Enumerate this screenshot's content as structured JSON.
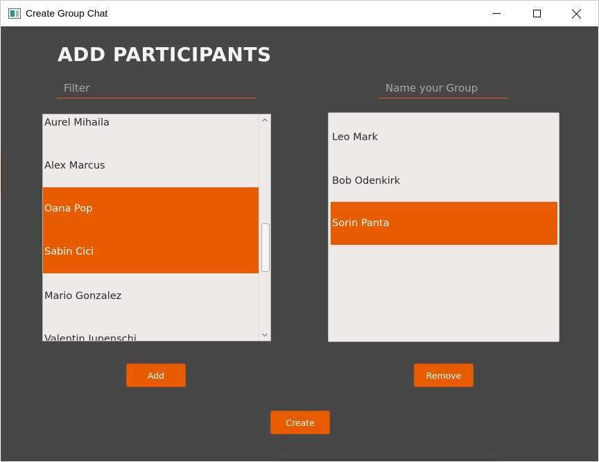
{
  "window": {
    "title": "Create Group Chat"
  },
  "heading": "ADD PARTICIPANTS",
  "filter": {
    "placeholder": "Filter",
    "value": ""
  },
  "group_name": {
    "placeholder": "Name your Group",
    "value": ""
  },
  "available_list": {
    "items": [
      {
        "label": "Aurel Mihaila",
        "selected": false
      },
      {
        "label": "Alex Marcus",
        "selected": false
      },
      {
        "label": "Oana Pop",
        "selected": true
      },
      {
        "label": "Sabin Cici",
        "selected": true
      },
      {
        "label": "Mario Gonzalez",
        "selected": false
      },
      {
        "label": "Valentin Jupenschi",
        "selected": false
      }
    ]
  },
  "participants_list": {
    "items": [
      {
        "label": "Leo Mark",
        "selected": false
      },
      {
        "label": "Bob Odenkirk",
        "selected": false
      },
      {
        "label": "Sorin Panta",
        "selected": true
      }
    ]
  },
  "buttons": {
    "add": "Add",
    "remove": "Remove",
    "create": "Create"
  },
  "colors": {
    "accent": "#e85c00",
    "background": "#474747",
    "list_background": "#eeeae9"
  }
}
